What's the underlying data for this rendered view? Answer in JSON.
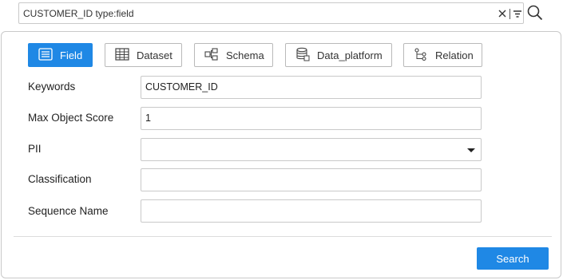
{
  "search_bar": {
    "query": "CUSTOMER_ID type:field"
  },
  "type_buttons": [
    {
      "label": "Field",
      "icon": "field-list-icon",
      "active": true
    },
    {
      "label": "Dataset",
      "icon": "table-icon",
      "active": false
    },
    {
      "label": "Schema",
      "icon": "schema-icon",
      "active": false
    },
    {
      "label": "Data_platform",
      "icon": "database-icon",
      "active": false
    },
    {
      "label": "Relation",
      "icon": "relation-icon",
      "active": false
    }
  ],
  "form": {
    "keywords": {
      "label": "Keywords",
      "value": "CUSTOMER_ID"
    },
    "max_object_score": {
      "label": "Max Object Score",
      "value": "1"
    },
    "pii": {
      "label": "PII",
      "value": ""
    },
    "classification": {
      "label": "Classification",
      "value": ""
    },
    "sequence_name": {
      "label": "Sequence Name",
      "value": ""
    }
  },
  "actions": {
    "search_label": "Search"
  },
  "colors": {
    "accent": "#1f88e5",
    "border": "#c9c9c9"
  }
}
